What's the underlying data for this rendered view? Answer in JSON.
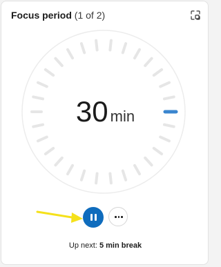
{
  "header": {
    "title": "Focus period",
    "counter": "(1 of 2)",
    "expand_icon": "expand-icon"
  },
  "timer": {
    "value": "30",
    "unit": "min",
    "progress_fraction": 0.0
  },
  "controls": {
    "pause_icon": "pause-icon",
    "more_icon": "more-dots-icon"
  },
  "annotation": {
    "arrow_icon": "arrow-right-icon",
    "arrow_color": "#f5e11b"
  },
  "up_next": {
    "label": "Up next:",
    "value": "5 min break"
  },
  "colors": {
    "accent": "#0f6cbd",
    "tick": "#e6e6e6",
    "ring": "#ececec"
  }
}
